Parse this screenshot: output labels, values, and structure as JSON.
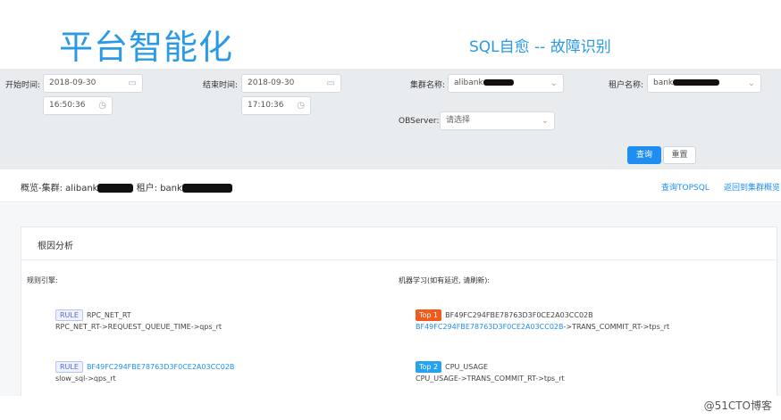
{
  "slide": {
    "title": "平台智能化",
    "subtitle": "SQL自愈 -- 故障识别"
  },
  "filters": {
    "start_label": "开始时间:",
    "start_date": "2018-09-30",
    "start_time": "16:50:36",
    "end_label": "结束时间:",
    "end_date": "2018-09-30",
    "end_time": "17:10:36",
    "cluster_label": "集群名称:",
    "cluster_value": "alibank",
    "tenant_label": "租户名称:",
    "tenant_value": "bank",
    "observer_label": "OBServer:",
    "observer_placeholder": "请选择",
    "query_button": "查询",
    "reset_button": "重置"
  },
  "overview": {
    "cluster_prefix": "概览-集群: alibank",
    "tenant_prefix": "租户: bank",
    "top_sql_link": "查询TOPSQL",
    "back_link": "返回到集群概览"
  },
  "root_cause": {
    "title": "根因分析",
    "rule_engine_title": "规则引擎:",
    "ml_title": "机器学习(如有延迟, 请刷新):",
    "rules": [
      {
        "tag": "RULE",
        "name": "RPC_NET_RT",
        "detail": "RPC_NET_RT->REQUEST_QUEUE_TIME->qps_rt"
      },
      {
        "tag": "RULE",
        "name": "BF49FC294FBE78763D3F0CE2A03CC02B",
        "detail": "slow_sql->qps_rt"
      }
    ],
    "ml": [
      {
        "tag": "Top 1",
        "name": "BF49FC294FBE78763D3F0CE2A03CC02B",
        "detail_link": "BF49FC294FBE78763D3F0CE2A03CC02B",
        "detail_rest": "->TRANS_COMMIT_RT->tps_rt"
      },
      {
        "tag": "Top 2",
        "name": "CPU_USAGE",
        "detail": "CPU_USAGE->TRANS_COMMIT_RT->tps_rt"
      }
    ]
  },
  "watermark": "@51CTO博客",
  "colors": {
    "accent": "#1f8ef0",
    "title_blue": "#2a9ae6",
    "top1": "#f05a1a",
    "top2": "#25a2f0",
    "panel_bg": "#e9ecef"
  },
  "icons": {
    "date": "calendar-icon",
    "time": "clock-icon",
    "select": "chevron-down-icon"
  }
}
